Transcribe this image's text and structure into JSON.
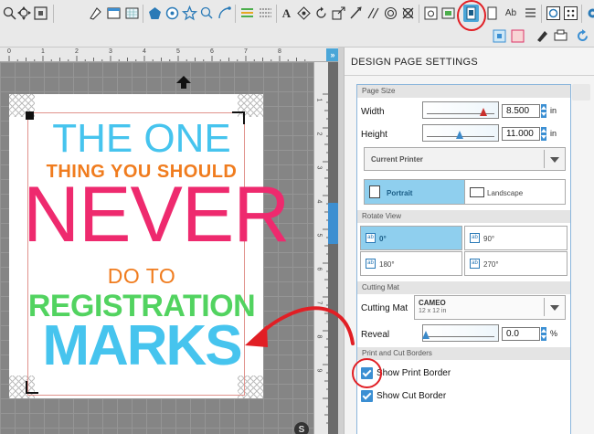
{
  "toolbar": {
    "tools": [
      {
        "name": "zoom-in-icon",
        "glyph": "+"
      },
      {
        "name": "fit-to-page-icon",
        "glyph": "⊕"
      },
      {
        "name": "select-icon",
        "glyph": "⊞"
      },
      {
        "name": "fill-panel-icon"
      },
      {
        "name": "page-panel-icon"
      },
      {
        "name": "grid-panel-icon"
      },
      {
        "name": "polygon-icon"
      },
      {
        "name": "shape-icon"
      },
      {
        "name": "star-icon"
      },
      {
        "name": "magnify-shape-icon"
      },
      {
        "name": "trace-icon"
      },
      {
        "name": "align-icon"
      },
      {
        "name": "line-style-icon"
      },
      {
        "name": "text-tool-icon",
        "glyph": "A"
      },
      {
        "name": "transform-icon"
      },
      {
        "name": "rotate-icon"
      },
      {
        "name": "scale-icon"
      },
      {
        "name": "knife-icon"
      },
      {
        "name": "eraser-icon"
      },
      {
        "name": "offset-icon"
      },
      {
        "name": "image-icon"
      },
      {
        "name": "library-icon"
      },
      {
        "name": "color-fill-icon"
      },
      {
        "name": "design-page-settings-icon"
      },
      {
        "name": "page-setup-icon"
      },
      {
        "name": "text-style-icon",
        "glyph": "Ab"
      },
      {
        "name": "list-icon"
      },
      {
        "name": "registration-icon"
      },
      {
        "name": "send-icon"
      },
      {
        "name": "settings-gear-icon"
      }
    ]
  },
  "poster": {
    "line1": "THE ONE",
    "line2": "THING YOU SHOULD",
    "line3": "NEVER",
    "line4": "DO TO",
    "line5": "REGISTRATION",
    "line6": "MARKS"
  },
  "rulers": {
    "h_numbers": [
      "0",
      "1",
      "2",
      "3",
      "4",
      "5",
      "6",
      "7",
      "8"
    ],
    "v_numbers": [
      "1",
      "2",
      "3",
      "4",
      "5",
      "6",
      "7",
      "8",
      "9"
    ]
  },
  "panel": {
    "title": "DESIGN PAGE SETTINGS",
    "page_size": {
      "header": "Page Size",
      "width_label": "Width",
      "width_value": "8.500",
      "width_unit": "in",
      "height_label": "Height",
      "height_value": "11.000",
      "height_unit": "in",
      "printer_option": "Current Printer",
      "orientation": [
        {
          "label": "Portrait",
          "selected": true
        },
        {
          "label": "Landscape",
          "selected": false
        }
      ]
    },
    "rotate_view": {
      "header": "Rotate View",
      "options": [
        {
          "label": "0°",
          "selected": true
        },
        {
          "label": "90°",
          "selected": false
        },
        {
          "label": "180°",
          "selected": false
        },
        {
          "label": "270°",
          "selected": false
        }
      ]
    },
    "cutting_mat": {
      "header": "Cutting Mat",
      "label": "Cutting Mat",
      "mat_name": "CAMEO",
      "mat_size": "12 x 12 in",
      "reveal_label": "Reveal",
      "reveal_value": "0.0",
      "reveal_unit": "%"
    },
    "borders": {
      "header": "Print and Cut Borders",
      "show_print_border": {
        "label": "Show Print Border",
        "checked": true
      },
      "show_cut_border": {
        "label": "Show Cut Border",
        "checked": true
      }
    }
  },
  "colors": {
    "accent": "#3b8fd3",
    "callout": "#e11f25",
    "poster_blue": "#46c4ee",
    "poster_orange": "#f07c1e",
    "poster_pink": "#ee2a6e",
    "poster_green": "#52d360"
  }
}
